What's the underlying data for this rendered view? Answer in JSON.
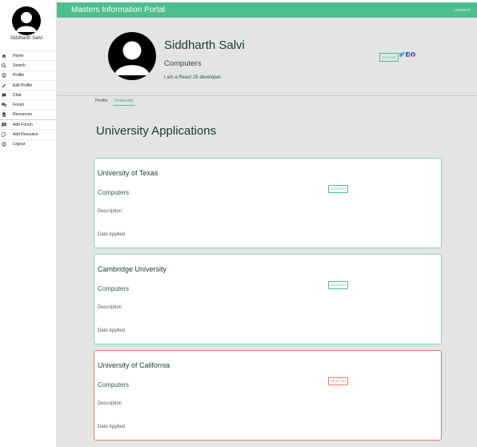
{
  "app": {
    "title": "Masters Information Portal",
    "logout": "LOGOUT"
  },
  "sidebar": {
    "user_name": "Siddharth Salvi",
    "items": [
      {
        "label": "Home",
        "icon": "home-icon"
      },
      {
        "label": "Search",
        "icon": "search-icon"
      },
      {
        "label": "Profile",
        "icon": "user-icon"
      },
      {
        "label": "Edit Profile",
        "icon": "pencil-icon"
      },
      {
        "label": "Chat",
        "icon": "chat-icon"
      },
      {
        "label": "Forum",
        "icon": "forum-icon"
      },
      {
        "label": "Resources",
        "icon": "document-icon"
      },
      {
        "label": "Add Forum",
        "icon": "add-forum-icon"
      },
      {
        "label": "Add Resource",
        "icon": "edit-document-icon"
      },
      {
        "label": "Logout",
        "icon": "logout-icon"
      }
    ]
  },
  "profile": {
    "name": "Siddharth Salvi",
    "department": "Computers",
    "bio": "I am a React JS developer.",
    "follow_label": "FOLLOW",
    "social_icons": [
      "twitter-icon",
      "facebook-icon",
      "github-icon"
    ]
  },
  "tabs": [
    {
      "label": "Profile",
      "active": false
    },
    {
      "label": "University",
      "active": true
    }
  ],
  "section_title": "University Applications",
  "applications": [
    {
      "university": "University of Texas",
      "department": "Computers",
      "description": "Description",
      "date": "Date Applied",
      "status": "ACCEPTED"
    },
    {
      "university": "Cambridge University",
      "department": "Computers",
      "description": "Description",
      "date": "Date Applied",
      "status": "ACCEPTED"
    },
    {
      "university": "University of California",
      "department": "Computers",
      "description": "Description",
      "date": "Date Applied",
      "status": "REJECTED"
    }
  ],
  "colors": {
    "accent": "#4cbf8e",
    "rejected": "#e0806a",
    "background": "#e4e4e4"
  }
}
